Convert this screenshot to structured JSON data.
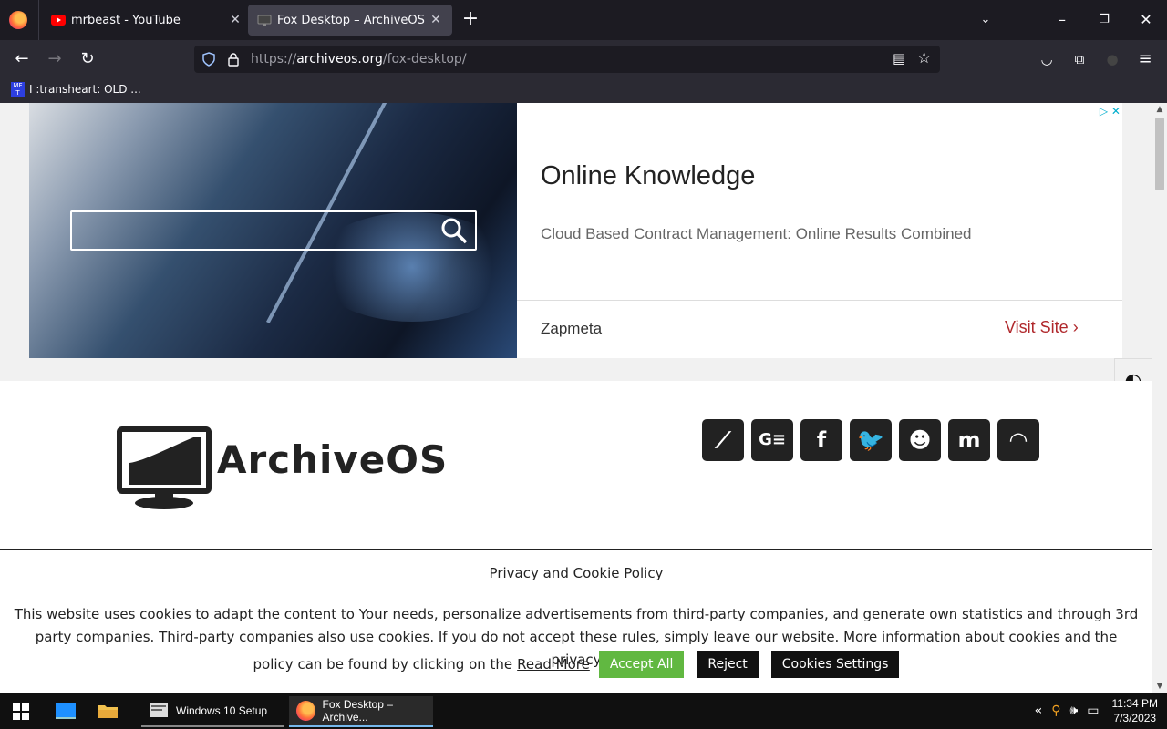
{
  "browser": {
    "tabs": [
      {
        "title": "mrbeast - YouTube",
        "active": false
      },
      {
        "title": "Fox Desktop – ArchiveOS",
        "active": true
      }
    ],
    "url_prefix": "https://",
    "url_host": "archiveos.org",
    "url_path": "/fox-desktop/",
    "bookmark": "I :transheart: OLD ..."
  },
  "ad": {
    "title": "Online Knowledge",
    "description": "Cloud Based Contract Management: Online Results Combined",
    "brand": "Zapmeta",
    "cta": "Visit Site"
  },
  "site": {
    "logo_text": "ArchiveOS",
    "social_icons": [
      "distrowatch-icon",
      "google-news-icon",
      "facebook-icon",
      "twitter-icon",
      "reddit-icon",
      "mastodon-icon",
      "rss-icon"
    ]
  },
  "cookie": {
    "title": "Privacy and Cookie Policy",
    "body": "This website uses cookies to adapt the content to Your needs, personalize advertisements from third-party companies, and generate own statistics and through 3rd party companies. Third-party companies also use cookies. If you do not accept these rules, simply leave our website. More information about cookies and the privacy",
    "tail": "policy can be found by clicking on the",
    "read_more": "Read More",
    "accept": "Accept All",
    "reject": "Reject",
    "settings": "Cookies Settings"
  },
  "taskbar": {
    "apps": [
      "Windows 10 Setup",
      "Fox Desktop – Archive..."
    ],
    "time": "11:34 PM",
    "date": "7/3/2023"
  },
  "colors": {
    "accept": "#61b841",
    "cta": "#b0282c",
    "tab_active": "#42414d"
  }
}
